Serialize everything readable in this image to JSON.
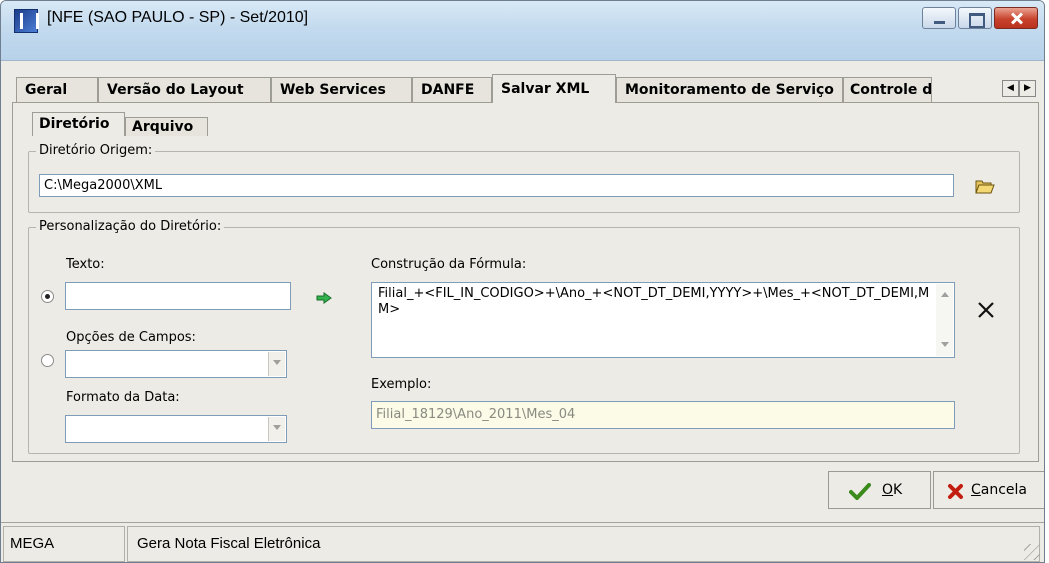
{
  "window": {
    "title": "[NFE (SAO PAULO - SP) - Set/2010]"
  },
  "tabs": [
    {
      "label": "Geral"
    },
    {
      "label": "Versão do Layout"
    },
    {
      "label": "Web Services"
    },
    {
      "label": "DANFE"
    },
    {
      "label": "Salvar XML"
    },
    {
      "label": "Monitoramento de Serviço"
    },
    {
      "label": "Controle d"
    }
  ],
  "active_tab": "Salvar XML",
  "subtabs": [
    {
      "label": "Diretório"
    },
    {
      "label": "Arquivo"
    }
  ],
  "origem": {
    "legend": "Diretório Origem:",
    "value": "C:\\Mega2000\\XML"
  },
  "personalizacao": {
    "legend": "Personalização do Diretório:",
    "texto_label": "Texto:",
    "texto_value": "",
    "opcoes_label": "Opções de Campos:",
    "formato_label": "Formato da Data:",
    "formula_label": "Construção da Fórmula:",
    "formula_value": "Filial_+<FIL_IN_CODIGO>+\\Ano_+<NOT_DT_DEMI,YYYY>+\\Mes_+<NOT_DT_DEMI,MM>",
    "exemplo_label": "Exemplo:",
    "exemplo_value": "Filial_18129\\Ano_2011\\Mes_04"
  },
  "buttons": {
    "ok_prefix": "",
    "ok_ul": "O",
    "ok_rest": "K",
    "cancel_ul": "C",
    "cancel_rest": "ancela"
  },
  "status": {
    "panel1": "MEGA",
    "panel2": "Gera Nota Fiscal Eletrônica"
  },
  "colors": {
    "ok_check": "#3a8a1c",
    "cancel_x": "#c21d0f",
    "accent_arrow": "#1f9a52"
  },
  "icons": {
    "app": "mega-logo-icon",
    "folder": "folder-open-icon",
    "add": "arrow-right-icon",
    "clear": "clear-x-icon"
  }
}
